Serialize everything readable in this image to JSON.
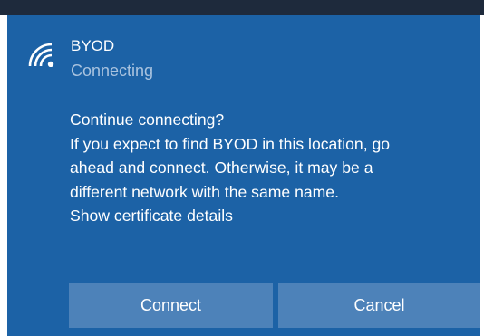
{
  "network": {
    "icon": "wifi-signal-icon",
    "name": "BYOD",
    "status": "Connecting"
  },
  "message": {
    "lines": [
      "Continue connecting?",
      "If you expect to find BYOD in this location, go",
      "ahead and connect. Otherwise, it may be a",
      "different network with the same name."
    ],
    "certificate_link": "Show certificate details"
  },
  "buttons": {
    "connect": "Connect",
    "cancel": "Cancel"
  },
  "colors": {
    "panel_background": "#1c62a6",
    "button_background": "#4d82b9",
    "status_text": "#a9c3df",
    "top_strip": "#1e2a3c"
  }
}
